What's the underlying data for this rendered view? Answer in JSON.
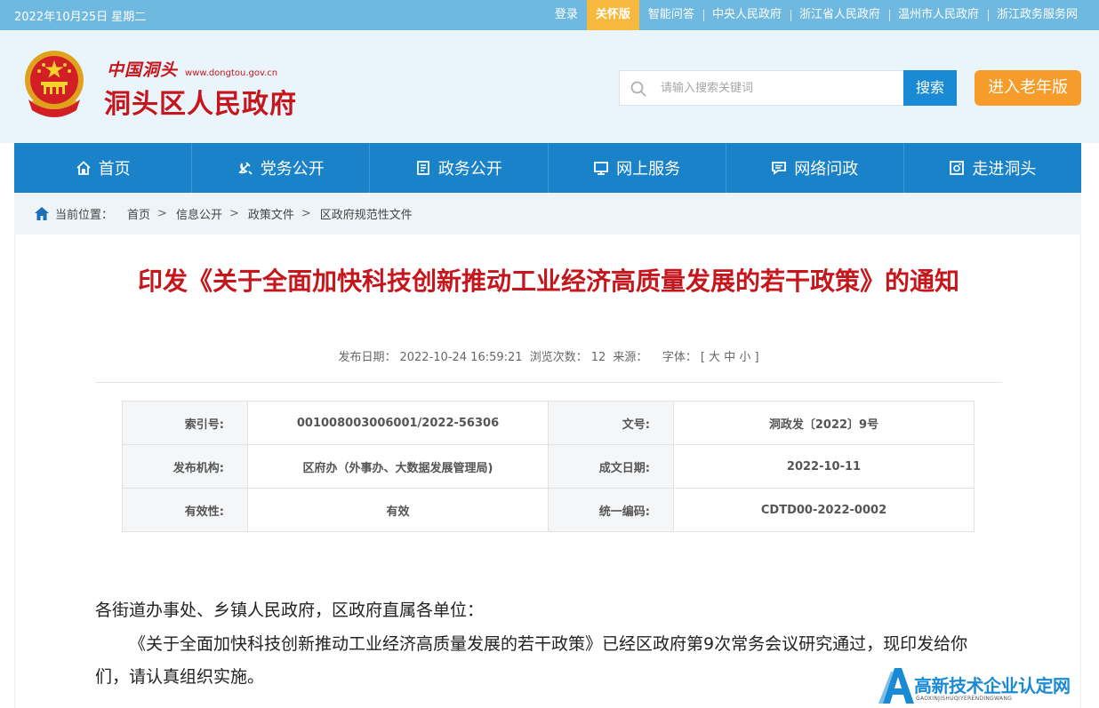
{
  "topbar": {
    "date": "2022年10月25日 星期二",
    "links": [
      "登录",
      "关怀版",
      "智能问答",
      "中央人民政府",
      "浙江省人民政府",
      "温州市人民政府",
      "浙江政务服务网"
    ]
  },
  "header": {
    "brand_small": "中国洞头",
    "brand_url": "www.dongtou.gov.cn",
    "brand_big": "洞头区人民政府",
    "search_placeholder": "请输入搜索关键词",
    "search_button": "搜索",
    "elder_button": "进入老年版"
  },
  "nav": {
    "items": [
      {
        "label": "首页",
        "icon": "home-icon"
      },
      {
        "label": "党务公开",
        "icon": "party-icon"
      },
      {
        "label": "政务公开",
        "icon": "document-icon"
      },
      {
        "label": "网上服务",
        "icon": "monitor-icon"
      },
      {
        "label": "网络问政",
        "icon": "message-icon"
      },
      {
        "label": "走进洞头",
        "icon": "photo-icon"
      }
    ]
  },
  "breadcrumb": {
    "label": "当前位置：",
    "items": [
      "首页",
      "信息公开",
      "政策文件",
      "区政府规范性文件"
    ]
  },
  "article": {
    "title": "印发《关于全面加快科技创新推动工业经济高质量发展的若干政策》的通知",
    "meta": {
      "date_label": "发布日期：",
      "date": "2022-10-24 16:59:21",
      "views_label": "浏览次数：",
      "views": "12",
      "source_label": "来源：",
      "font_label": "字体：",
      "font_sizes": "[ 大 中 小 ]"
    },
    "info": [
      {
        "k1": "索引号:",
        "v1": "001008003006001/2022-56306",
        "k2": "文号:",
        "v2": "洞政发〔2022〕9号"
      },
      {
        "k1": "发布机构:",
        "v1": "区府办（外事办、大数据发展管理局)",
        "k2": "成文日期:",
        "v2": "2022-10-11"
      },
      {
        "k1": "有效性:",
        "v1": "有效",
        "k2": "统一编码:",
        "v2": "CDTD00-2022-0002"
      }
    ],
    "salutation": "各街道办事处、乡镇人民政府，区政府直属各单位：",
    "paragraph": "《关于全面加快科技创新推动工业经济高质量发展的若干政策》已经区政府第9次常务会议研究通过，现印发给你们，请认真组织实施。"
  },
  "watermark": {
    "text": "高新技术企业认定网",
    "sub": "GAOXINJISHUQIYERENDINGWANG"
  },
  "colors": {
    "topbar": "#6fb8e0",
    "care": "#f6b93d",
    "nav": "#1a82c9",
    "brand_red": "#c4161c",
    "search_btn": "#1a8ad4",
    "elder_btn": "#f59c2b"
  }
}
